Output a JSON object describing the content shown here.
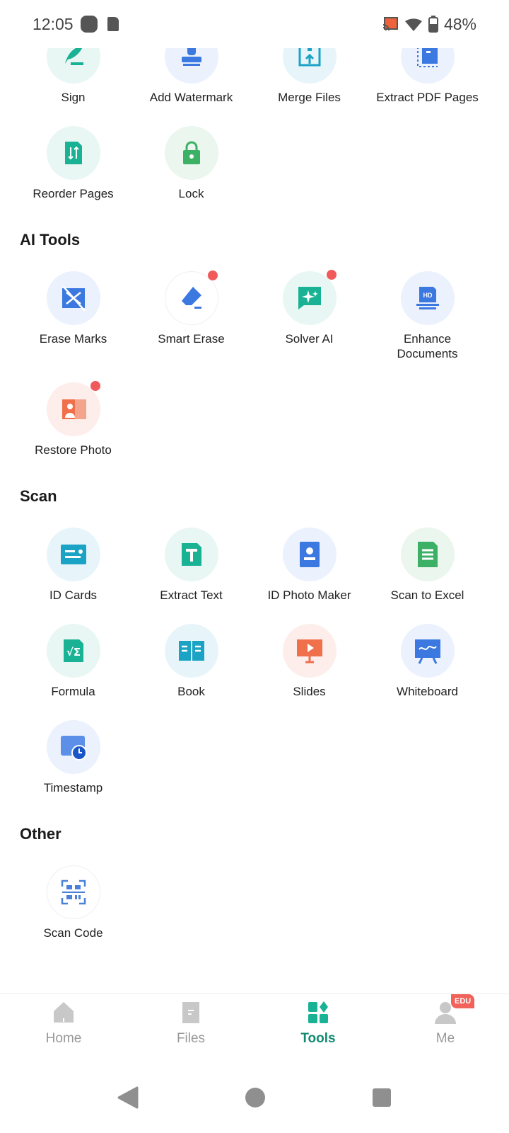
{
  "status": {
    "time": "12:05",
    "battery": "48%"
  },
  "sections": [
    {
      "title": "",
      "tools": [
        {
          "label": "Sign",
          "icon": "sign-icon",
          "bg": "#e8f7f3",
          "dot": false
        },
        {
          "label": "Add Watermark",
          "icon": "stamp-icon",
          "bg": "#ebf1fd",
          "dot": false
        },
        {
          "label": "Merge Files",
          "icon": "merge-icon",
          "bg": "#e7f5fa",
          "dot": false
        },
        {
          "label": "Extract PDF Pages",
          "icon": "extract-pages-icon",
          "bg": "#ebf1fd",
          "dot": false
        },
        {
          "label": "Reorder Pages",
          "icon": "reorder-icon",
          "bg": "#e8f7f3",
          "dot": false
        },
        {
          "label": "Lock",
          "icon": "lock-icon",
          "bg": "#eaf6ee",
          "dot": false
        }
      ]
    },
    {
      "title": "AI Tools",
      "tools": [
        {
          "label": "Erase Marks",
          "icon": "erase-marks-icon",
          "bg": "#ebf1fd",
          "dot": false
        },
        {
          "label": "Smart Erase",
          "icon": "eraser-icon",
          "bg": "#ffffff",
          "dot": true
        },
        {
          "label": "Solver AI",
          "icon": "ai-chat-icon",
          "bg": "#e8f7f3",
          "dot": true
        },
        {
          "label": "Enhance Documents",
          "icon": "hd-icon",
          "bg": "#ebf1fd",
          "dot": false
        },
        {
          "label": "Restore Photo",
          "icon": "restore-photo-icon",
          "bg": "#fdeeeb",
          "dot": true
        }
      ]
    },
    {
      "title": "Scan",
      "tools": [
        {
          "label": "ID Cards",
          "icon": "id-card-icon",
          "bg": "#e7f5fa",
          "dot": false
        },
        {
          "label": "Extract Text",
          "icon": "text-icon",
          "bg": "#e8f7f3",
          "dot": false
        },
        {
          "label": "ID Photo Maker",
          "icon": "id-photo-icon",
          "bg": "#ebf1fd",
          "dot": false
        },
        {
          "label": "Scan to Excel",
          "icon": "excel-icon",
          "bg": "#eaf6ee",
          "dot": false
        },
        {
          "label": "Formula",
          "icon": "formula-icon",
          "bg": "#e8f7f3",
          "dot": false
        },
        {
          "label": "Book",
          "icon": "book-icon",
          "bg": "#e7f5fa",
          "dot": false
        },
        {
          "label": "Slides",
          "icon": "slides-icon",
          "bg": "#fdeeeb",
          "dot": false
        },
        {
          "label": "Whiteboard",
          "icon": "whiteboard-icon",
          "bg": "#ebf1fd",
          "dot": false
        },
        {
          "label": "Timestamp",
          "icon": "timestamp-icon",
          "bg": "#ebf1fd",
          "dot": false
        }
      ]
    },
    {
      "title": "Other",
      "tools": [
        {
          "label": "Scan Code",
          "icon": "qr-scan-icon",
          "bg": "#ffffff",
          "dot": false
        }
      ]
    }
  ],
  "nav": [
    {
      "label": "Home",
      "icon": "home-icon"
    },
    {
      "label": "Files",
      "icon": "files-icon"
    },
    {
      "label": "Tools",
      "icon": "tools-icon",
      "active": true
    },
    {
      "label": "Me",
      "icon": "user-icon",
      "badge": "EDU"
    }
  ],
  "colors": {
    "accent": "#138a72",
    "badge": "#f05a5a"
  }
}
